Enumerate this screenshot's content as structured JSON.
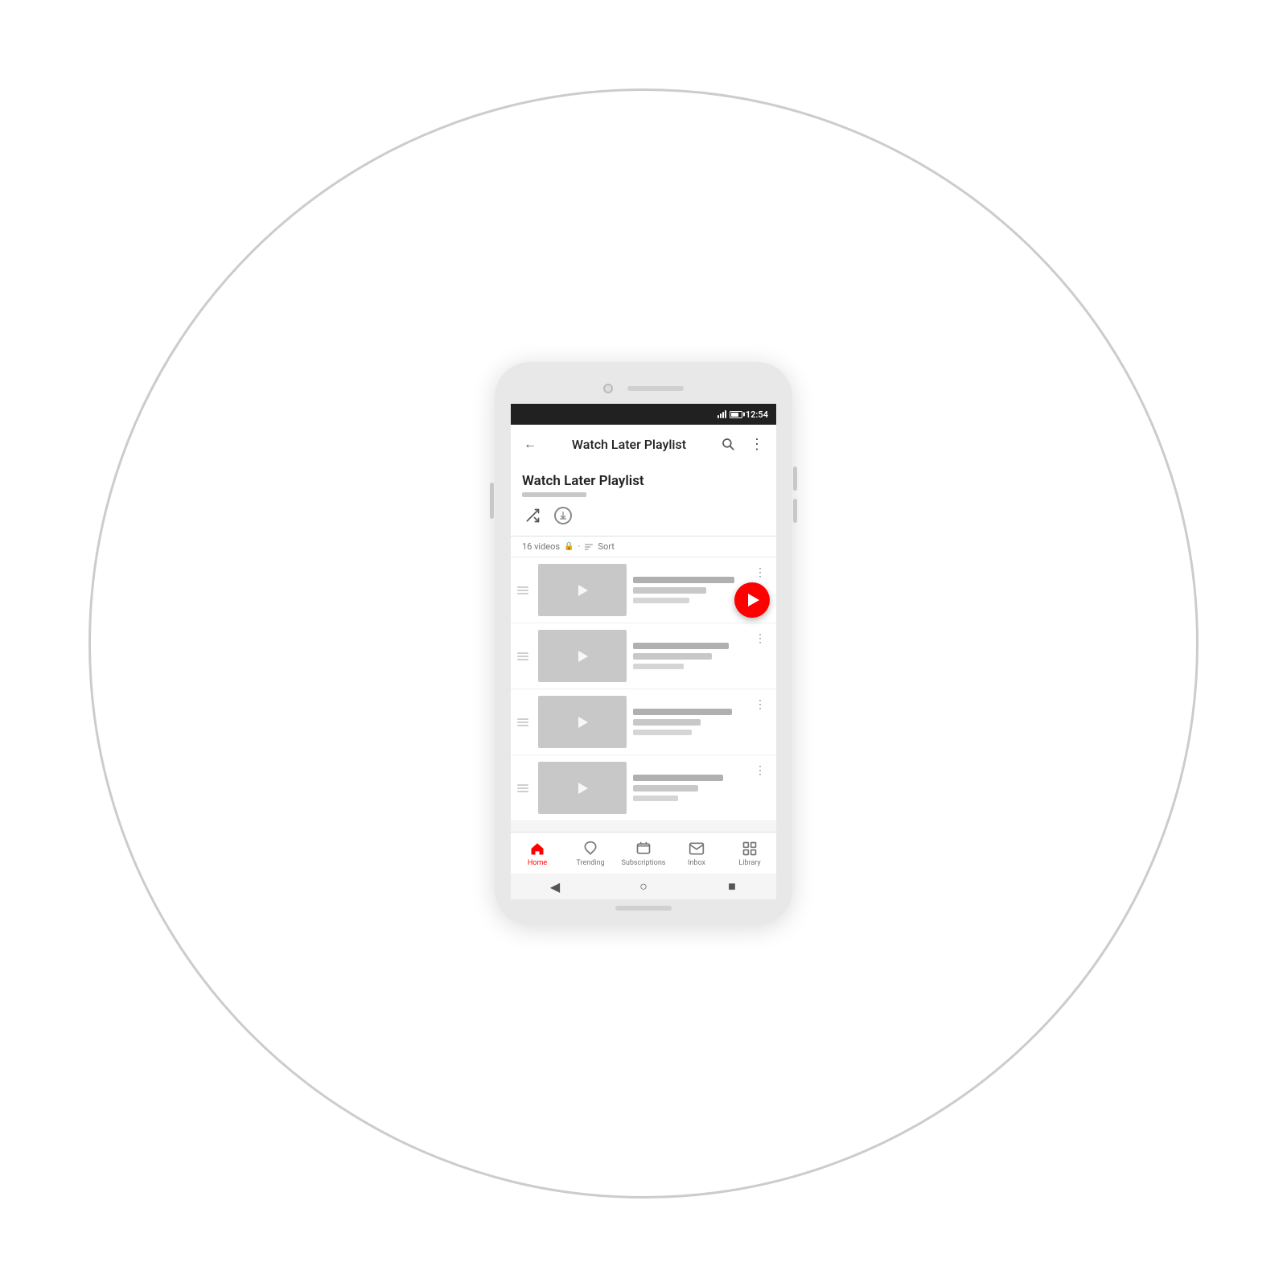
{
  "page": {
    "background_color": "#ffffff",
    "circle_border_color": "#cccccc"
  },
  "status_bar": {
    "time": "12:54",
    "background": "#212121"
  },
  "app_bar": {
    "title": "Watch Later Playlist",
    "back_label": "←",
    "search_label": "⌕",
    "more_label": "⋮"
  },
  "playlist": {
    "title": "Watch Later Playlist",
    "video_count": "16 videos",
    "sort_label": "Sort"
  },
  "videos": [
    {
      "id": 1
    },
    {
      "id": 2
    },
    {
      "id": 3
    },
    {
      "id": 4
    }
  ],
  "bottom_nav": {
    "items": [
      {
        "id": "home",
        "label": "Home",
        "active": true
      },
      {
        "id": "trending",
        "label": "Trending",
        "active": false
      },
      {
        "id": "subscriptions",
        "label": "Subscriptions",
        "active": false
      },
      {
        "id": "inbox",
        "label": "Inbox",
        "active": false
      },
      {
        "id": "library",
        "label": "Library",
        "active": false
      }
    ]
  },
  "system_nav": {
    "back_label": "◀",
    "home_label": "○",
    "recents_label": "■"
  }
}
